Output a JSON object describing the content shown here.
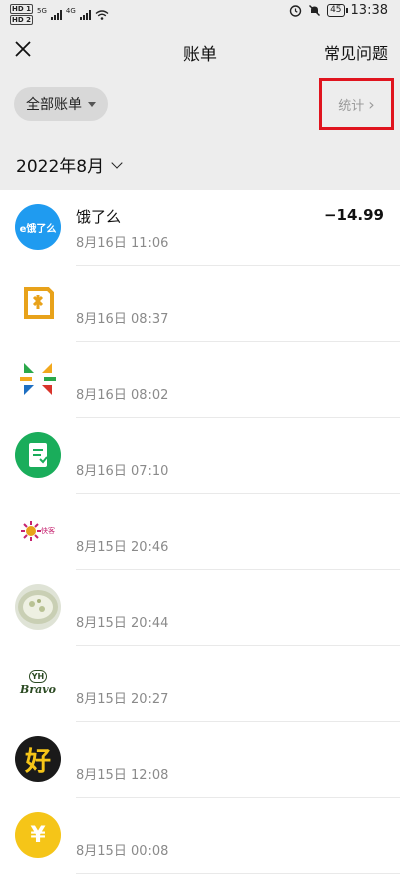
{
  "status_bar": {
    "sim1": "HD 1",
    "sim2": "HD 2",
    "net1": "5G",
    "net2": "4G",
    "battery": "45",
    "time": "13:38"
  },
  "nav": {
    "title": "账单",
    "faq": "常见问题"
  },
  "filter": {
    "all_bills": "全部账单",
    "stats": "统计",
    "stats_chevron": "›"
  },
  "month": {
    "label": "2022年8月"
  },
  "transactions": [
    {
      "merchant": "饿了么",
      "time": "8月16日 11:06",
      "amount": "−14.99",
      "logo": "eleme-logo"
    },
    {
      "merchant": "",
      "time": "8月16日 08:37",
      "amount": "",
      "logo": "yellow-square-logo"
    },
    {
      "merchant": "",
      "time": "8月16日 08:02",
      "amount": "",
      "logo": "colorful-arrows-logo"
    },
    {
      "merchant": "",
      "time": "8月16日 07:10",
      "amount": "",
      "logo": "green-receipt-logo"
    },
    {
      "merchant": "",
      "time": "8月15日 20:46",
      "amount": "",
      "logo": "sun-shop-logo"
    },
    {
      "merchant": "",
      "time": "8月15日 20:44",
      "amount": "",
      "logo": "food-photo-logo"
    },
    {
      "merchant": "",
      "time": "8月15日 20:27",
      "amount": "",
      "logo": "bravo-logo"
    },
    {
      "merchant": "",
      "time": "8月15日 12:08",
      "amount": "",
      "logo": "hao-logo"
    },
    {
      "merchant": "",
      "time": "8月15日 00:08",
      "amount": "",
      "logo": "yuan-coin-logo"
    }
  ],
  "logo_text": {
    "eleme": "e饿了么",
    "bravo_top": "YH",
    "bravo_name": "Bravo",
    "hao": "好",
    "yuan": "¥",
    "sun": "快客"
  },
  "colors": {
    "eleme_blue": "#1f9bf0",
    "highlight_red": "#e0141e",
    "green": "#1aad5b",
    "gold": "#f5c518"
  }
}
